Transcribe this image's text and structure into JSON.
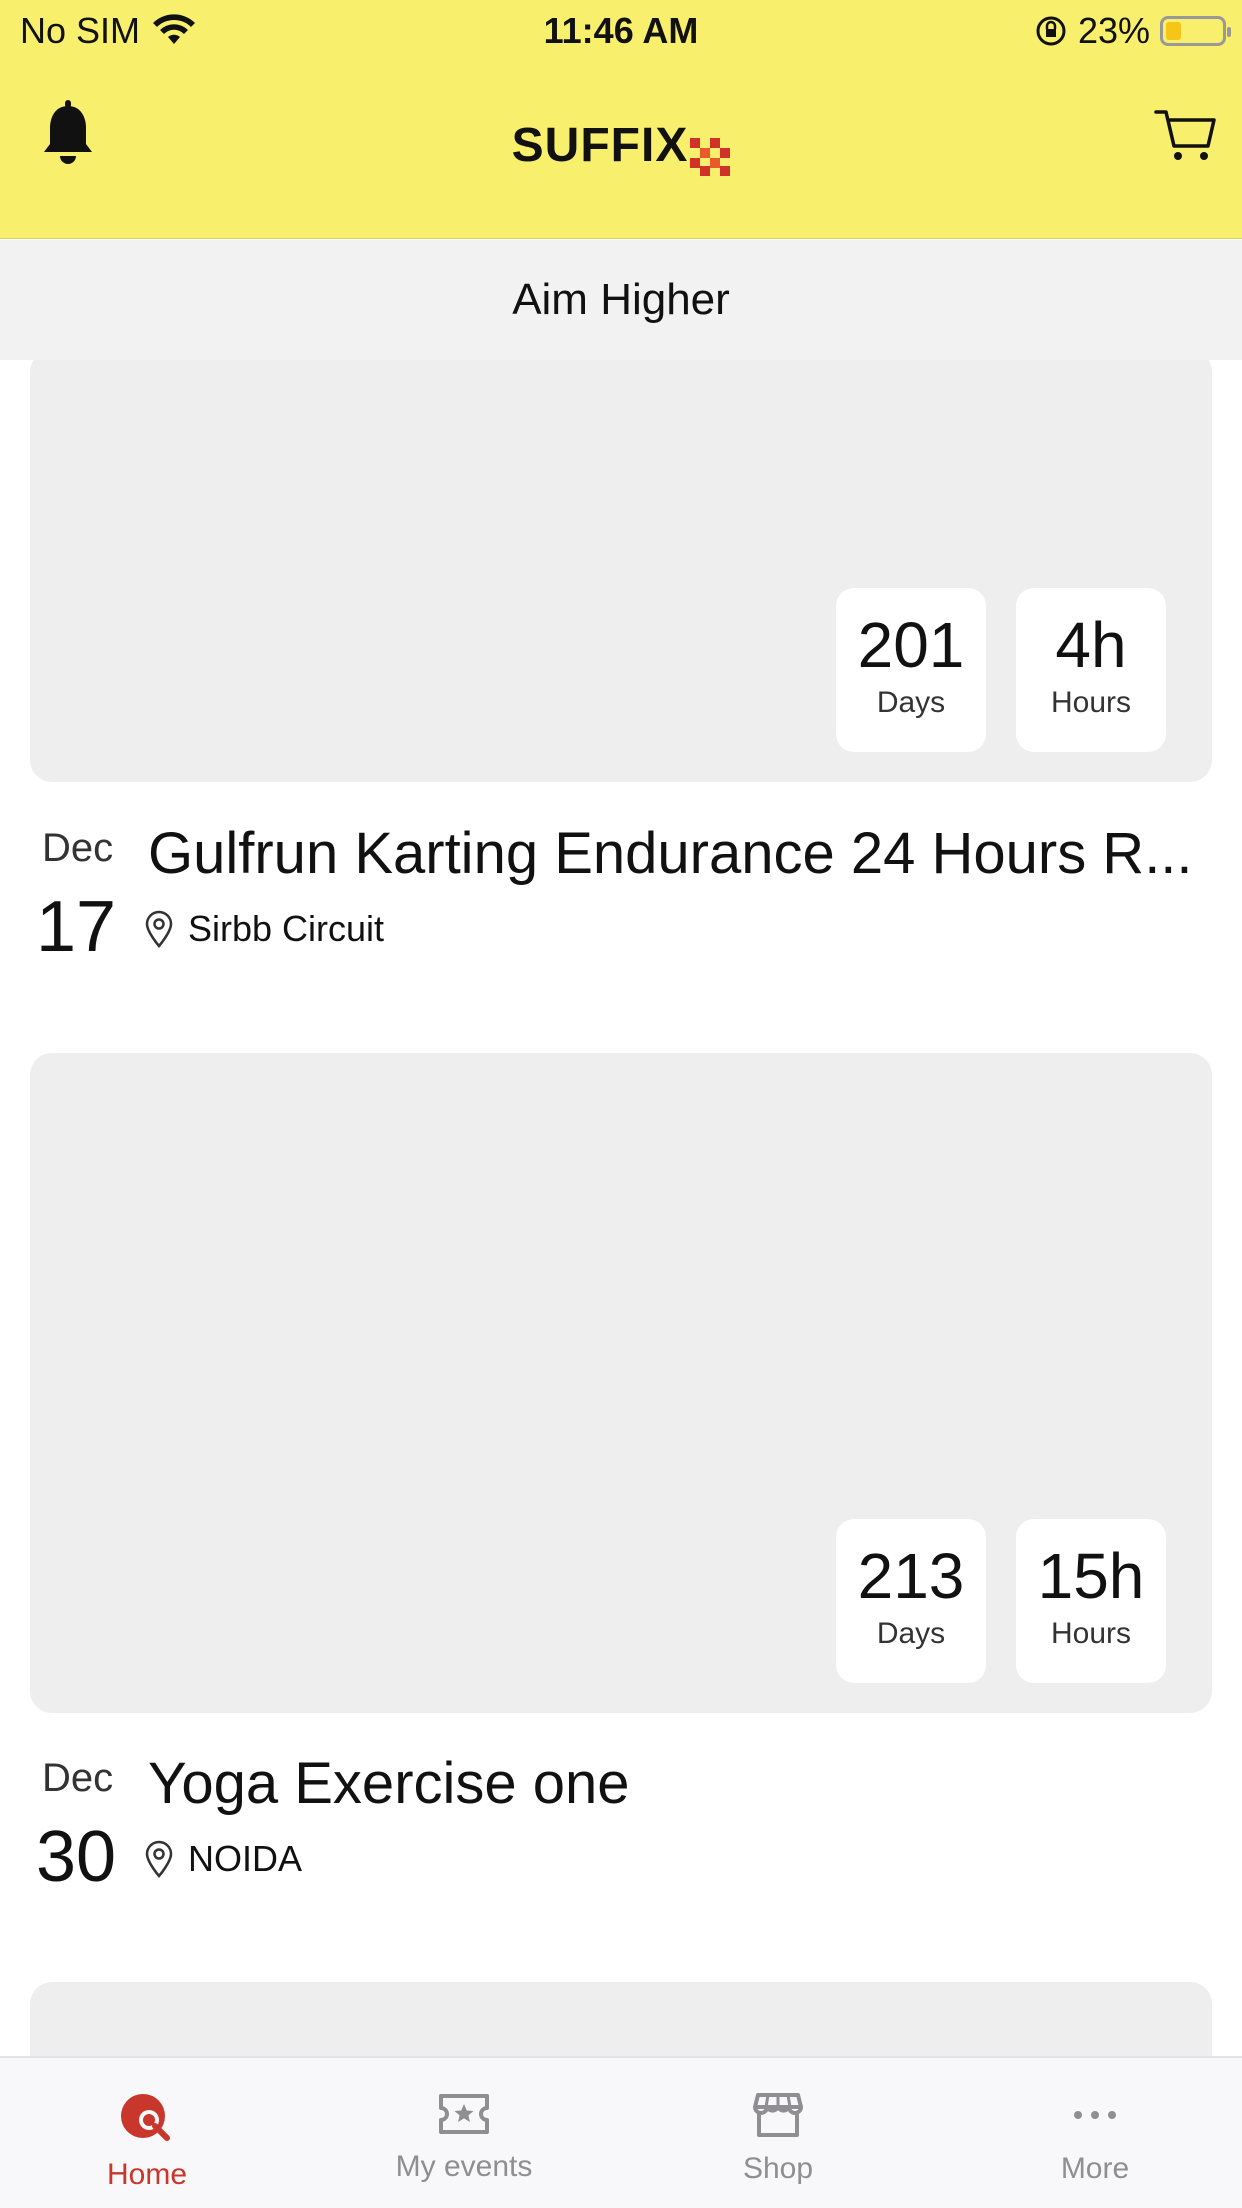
{
  "status_bar": {
    "carrier": "No SIM",
    "time": "11:46 AM",
    "battery": "23%",
    "battery_level": 0.23
  },
  "header": {
    "brand": "SUFFIX",
    "brand_accent_color": "#d0322a",
    "background_color": "#f8ef6c"
  },
  "subtitle": "Aim Higher",
  "events": [
    {
      "countdown_days": "201",
      "days_label": "Days",
      "countdown_hours": "4h",
      "hours_label": "Hours",
      "month": "Dec",
      "day": "17",
      "title": "Gulfrun Karting Endurance 24 Hours R...",
      "location": "Sirbb Circuit"
    },
    {
      "countdown_days": "213",
      "days_label": "Days",
      "countdown_hours": "15h",
      "hours_label": "Hours",
      "month": "Dec",
      "day": "30",
      "title": "Yoga Exercise one",
      "location": "NOIDA"
    }
  ],
  "tabs": [
    {
      "label": "Home",
      "icon": "home-search-icon",
      "active": true
    },
    {
      "label": "My events",
      "icon": "ticket-star-icon",
      "active": false
    },
    {
      "label": "Shop",
      "icon": "store-icon",
      "active": false
    },
    {
      "label": "More",
      "icon": "ellipsis-icon",
      "active": false
    }
  ]
}
